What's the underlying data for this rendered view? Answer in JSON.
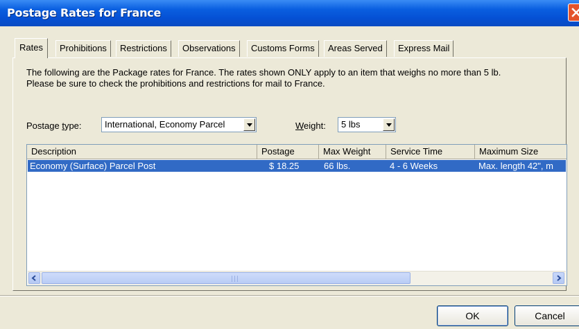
{
  "window": {
    "title": "Postage Rates for France"
  },
  "tabs": [
    {
      "label": "Rates"
    },
    {
      "label": "Prohibitions"
    },
    {
      "label": "Restrictions"
    },
    {
      "label": "Observations"
    },
    {
      "label": "Customs Forms"
    },
    {
      "label": "Areas Served"
    },
    {
      "label": "Express Mail"
    }
  ],
  "info": {
    "line1": "The following are the Package rates for France.  The rates shown ONLY apply to an item that weighs no more than 5 lb.",
    "line2": "Please be sure to check the prohibitions and restrictions for mail to France."
  },
  "postage_type": {
    "label_pre": "Postage ",
    "label_key": "t",
    "label_post": "ype:",
    "value": "International, Economy Parcel"
  },
  "weight": {
    "label_key": "W",
    "label_post": "eight:",
    "value": "5 lbs"
  },
  "table": {
    "columns": [
      "Description",
      "Postage",
      "Max Weight",
      "Service Time",
      "Maximum Size"
    ],
    "rows": [
      [
        "Economy (Surface) Parcel Post",
        "$ 18.25",
        "66 lbs.",
        "4 - 6 Weeks",
        "Max. length 42\", m"
      ]
    ]
  },
  "buttons": {
    "ok": "OK",
    "cancel": "Cancel"
  },
  "colors": {
    "titlebar": "#0a5fe0",
    "selection": "#316ac5",
    "close": "#e4542c"
  }
}
